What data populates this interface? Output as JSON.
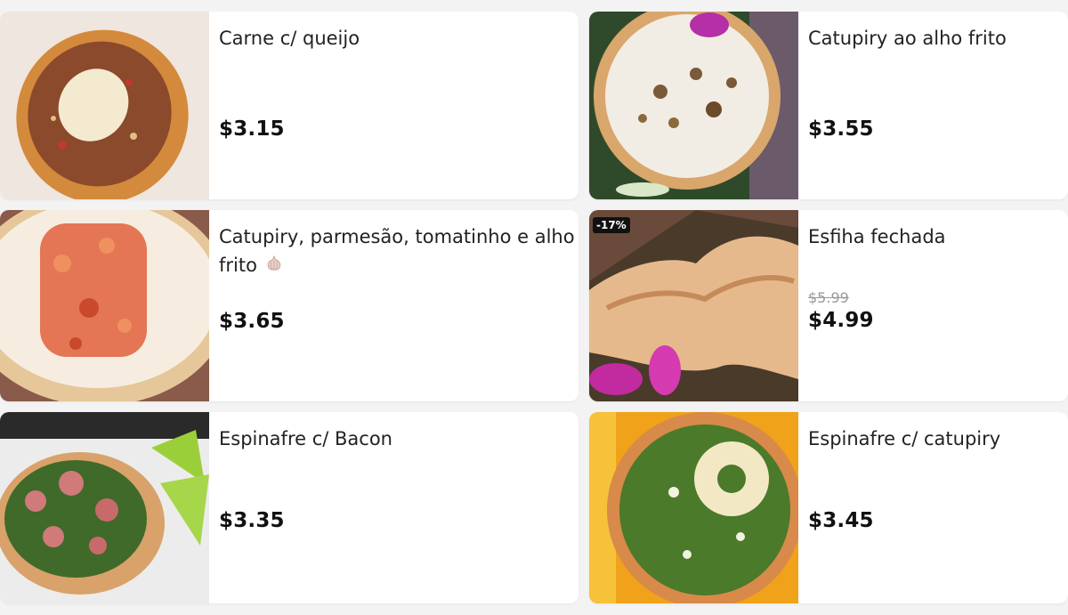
{
  "items": [
    {
      "name": "Carne c/ queijo",
      "price": "$3.15"
    },
    {
      "name": "Catupiry ao alho frito",
      "price": "$3.55"
    },
    {
      "name": "Catupiry, parmesão, tomatinho e alho frito",
      "price": "$3.65",
      "emoji_icon": "garlic-icon"
    },
    {
      "name": "Esfiha fechada",
      "price": "$4.99",
      "old_price": "$5.99",
      "badge": "-17%"
    },
    {
      "name": "Espinafre c/ Bacon",
      "price": "$3.35"
    },
    {
      "name": "Espinafre c/ catupiry",
      "price": "$3.45"
    }
  ],
  "colors": {
    "background": "#f3f3f3",
    "card": "#ffffff",
    "text": "#222222",
    "strike": "#9a9a9a",
    "badge": "#111111"
  }
}
